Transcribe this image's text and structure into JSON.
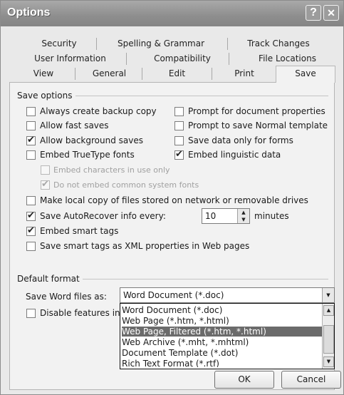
{
  "window": {
    "title": "Options",
    "help_glyph": "?",
    "close_glyph": "✕"
  },
  "tabs": {
    "row1": [
      "Security",
      "Spelling & Grammar",
      "Track Changes"
    ],
    "row2": [
      "User Information",
      "Compatibility",
      "File Locations"
    ],
    "row3": [
      "View",
      "General",
      "Edit",
      "Print",
      "Save"
    ],
    "active": "Save"
  },
  "save_options": {
    "group_label": "Save options",
    "items": [
      {
        "label": "Always create backup copy",
        "checked": false,
        "enabled": true
      },
      {
        "label": "Allow fast saves",
        "checked": false,
        "enabled": true
      },
      {
        "label": "Allow background saves",
        "checked": true,
        "enabled": true
      },
      {
        "label": "Embed TrueType fonts",
        "checked": false,
        "enabled": true
      },
      {
        "label": "Embed characters in use only",
        "checked": false,
        "enabled": false
      },
      {
        "label": "Do not embed common system fonts",
        "checked": true,
        "enabled": false
      },
      {
        "label": "Prompt for document properties",
        "checked": false,
        "enabled": true
      },
      {
        "label": "Prompt to save Normal template",
        "checked": false,
        "enabled": true
      },
      {
        "label": "Save data only for forms",
        "checked": false,
        "enabled": true
      },
      {
        "label": "Embed linguistic data",
        "checked": true,
        "enabled": true
      },
      {
        "label": "Make local copy of files stored on network or removable drives",
        "checked": false,
        "enabled": true
      },
      {
        "label": "Save AutoRecover info every:",
        "checked": true,
        "enabled": true
      },
      {
        "label": "Embed smart tags",
        "checked": true,
        "enabled": true
      },
      {
        "label": "Save smart tags as XML properties in Web pages",
        "checked": false,
        "enabled": true
      }
    ],
    "autorecover_value": "10",
    "autorecover_unit": "minutes",
    "check_glyph": "✔"
  },
  "default_format": {
    "group_label": "Default format",
    "save_as_label": "Save Word files as:",
    "selected_value": "Word Document (*.doc)",
    "disable_label": "Disable features intr",
    "disable_checked": false,
    "options": [
      "Word Document (*.doc)",
      "Web Page (*.htm, *.html)",
      "Web Page, Filtered (*.htm, *.html)",
      "Web Archive (*.mht, *.mhtml)",
      "Document Template (*.dot)",
      "Rich Text Format (*.rtf)"
    ],
    "highlighted_index": 2,
    "arrow_down": "▼",
    "arrow_up": "▲"
  },
  "buttons": {
    "ok": "OK",
    "cancel": "Cancel"
  }
}
